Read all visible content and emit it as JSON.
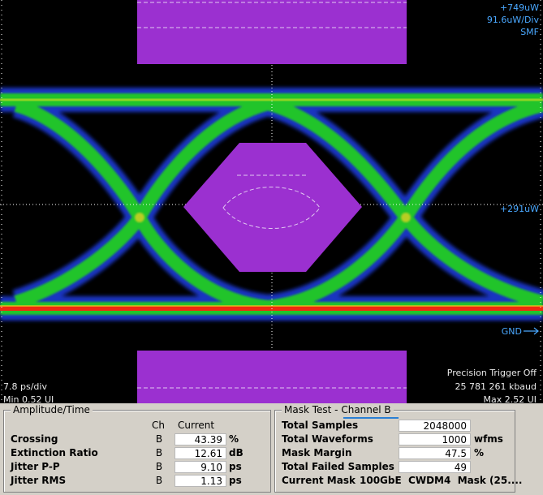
{
  "screen": {
    "scale_top": "+749uW",
    "scale_div": "91.6uW/Div",
    "fiber": "SMF",
    "mid_level": "+291uW",
    "gnd_label": "GND",
    "time_div": "7.8 ps/div",
    "min_ui": "Min 0.52 UI",
    "trigger": "Precision Trigger Off",
    "baud": "25 781 261 kbaud",
    "max_ui": "Max 2.52 UI",
    "colors": {
      "mask": "#9b30d0",
      "eye_green": "#22cc22",
      "eye_red": "#dd1111",
      "grid": "#ffffff"
    }
  },
  "amplitude_panel": {
    "title": "Amplitude/Time",
    "col_ch": "Ch",
    "col_current": "Current",
    "rows": [
      {
        "label": "Crossing",
        "ch": "B",
        "value": "43.39",
        "unit": "%"
      },
      {
        "label": "Extinction Ratio",
        "ch": "B",
        "value": "12.61",
        "unit": "dB"
      },
      {
        "label": "Jitter P-P",
        "ch": "B",
        "value": "9.10",
        "unit": "ps"
      },
      {
        "label": "Jitter RMS",
        "ch": "B",
        "value": "1.13",
        "unit": "ps"
      }
    ]
  },
  "mask_panel": {
    "title": "Mask Test -",
    "channel": "Channel B",
    "rows": [
      {
        "label": "Total Samples",
        "value": "2048000",
        "unit": ""
      },
      {
        "label": "Total Waveforms",
        "value": "1000",
        "unit": "wfms"
      },
      {
        "label": "Mask Margin",
        "value": "47.5",
        "unit": "%"
      },
      {
        "label": "Total Failed Samples",
        "value": "49",
        "unit": ""
      }
    ],
    "current_mask_label": "Current Mask",
    "current_mask_value": "100GbE  CWDM4  Mask (25...."
  }
}
